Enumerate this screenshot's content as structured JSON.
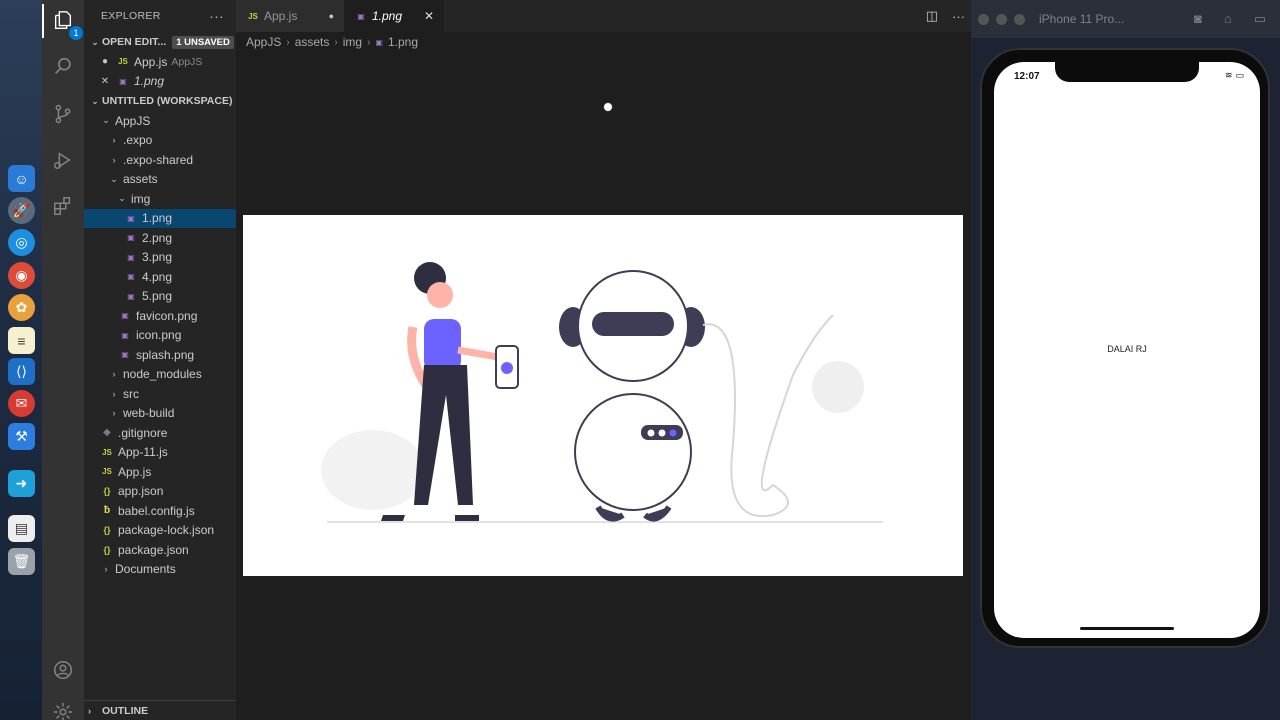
{
  "sidebar": {
    "title": "EXPLORER",
    "open_editors": {
      "label": "OPEN EDIT...",
      "badge": "1 UNSAVED",
      "items": [
        {
          "icon": "JS",
          "name": "App.js",
          "detail": "AppJS"
        },
        {
          "icon": "img",
          "name": "1.png",
          "detail": ""
        }
      ]
    },
    "workspace": {
      "label": "UNTITLED (WORKSPACE)",
      "tree": [
        {
          "name": "AppJS",
          "kind": "folder-open"
        },
        {
          "name": ".expo",
          "kind": "folder"
        },
        {
          "name": ".expo-shared",
          "kind": "folder"
        },
        {
          "name": "assets",
          "kind": "folder-open"
        },
        {
          "name": "img",
          "kind": "folder-open"
        },
        {
          "name": "1.png",
          "kind": "image"
        },
        {
          "name": "2.png",
          "kind": "image"
        },
        {
          "name": "3.png",
          "kind": "image"
        },
        {
          "name": "4.png",
          "kind": "image"
        },
        {
          "name": "5.png",
          "kind": "image"
        },
        {
          "name": "favicon.png",
          "kind": "image"
        },
        {
          "name": "icon.png",
          "kind": "image"
        },
        {
          "name": "splash.png",
          "kind": "image"
        },
        {
          "name": "node_modules",
          "kind": "folder"
        },
        {
          "name": "src",
          "kind": "folder"
        },
        {
          "name": "web-build",
          "kind": "folder"
        },
        {
          "name": ".gitignore",
          "kind": "git"
        },
        {
          "name": "App-11.js",
          "kind": "js"
        },
        {
          "name": "App.js",
          "kind": "js"
        },
        {
          "name": "app.json",
          "kind": "json"
        },
        {
          "name": "babel.config.js",
          "kind": "babel"
        },
        {
          "name": "package-lock.json",
          "kind": "json"
        },
        {
          "name": "package.json",
          "kind": "json"
        }
      ],
      "documents": "Documents"
    },
    "outline": "OUTLINE"
  },
  "activity": {
    "badge": "1"
  },
  "tabs": [
    {
      "icon": "JS",
      "label": "App.js"
    },
    {
      "icon": "img",
      "label": "1.png"
    }
  ],
  "breadcrumb": [
    "AppJS",
    "assets",
    "img",
    "1.png"
  ],
  "simulator": {
    "title": "iPhone 11 Pro...",
    "time": "12:07",
    "app_text": "DALAI RJ"
  },
  "colors": {
    "accent": "#0078d4",
    "selected_row": "#094771",
    "illustration_purple": "#6c63ff"
  }
}
